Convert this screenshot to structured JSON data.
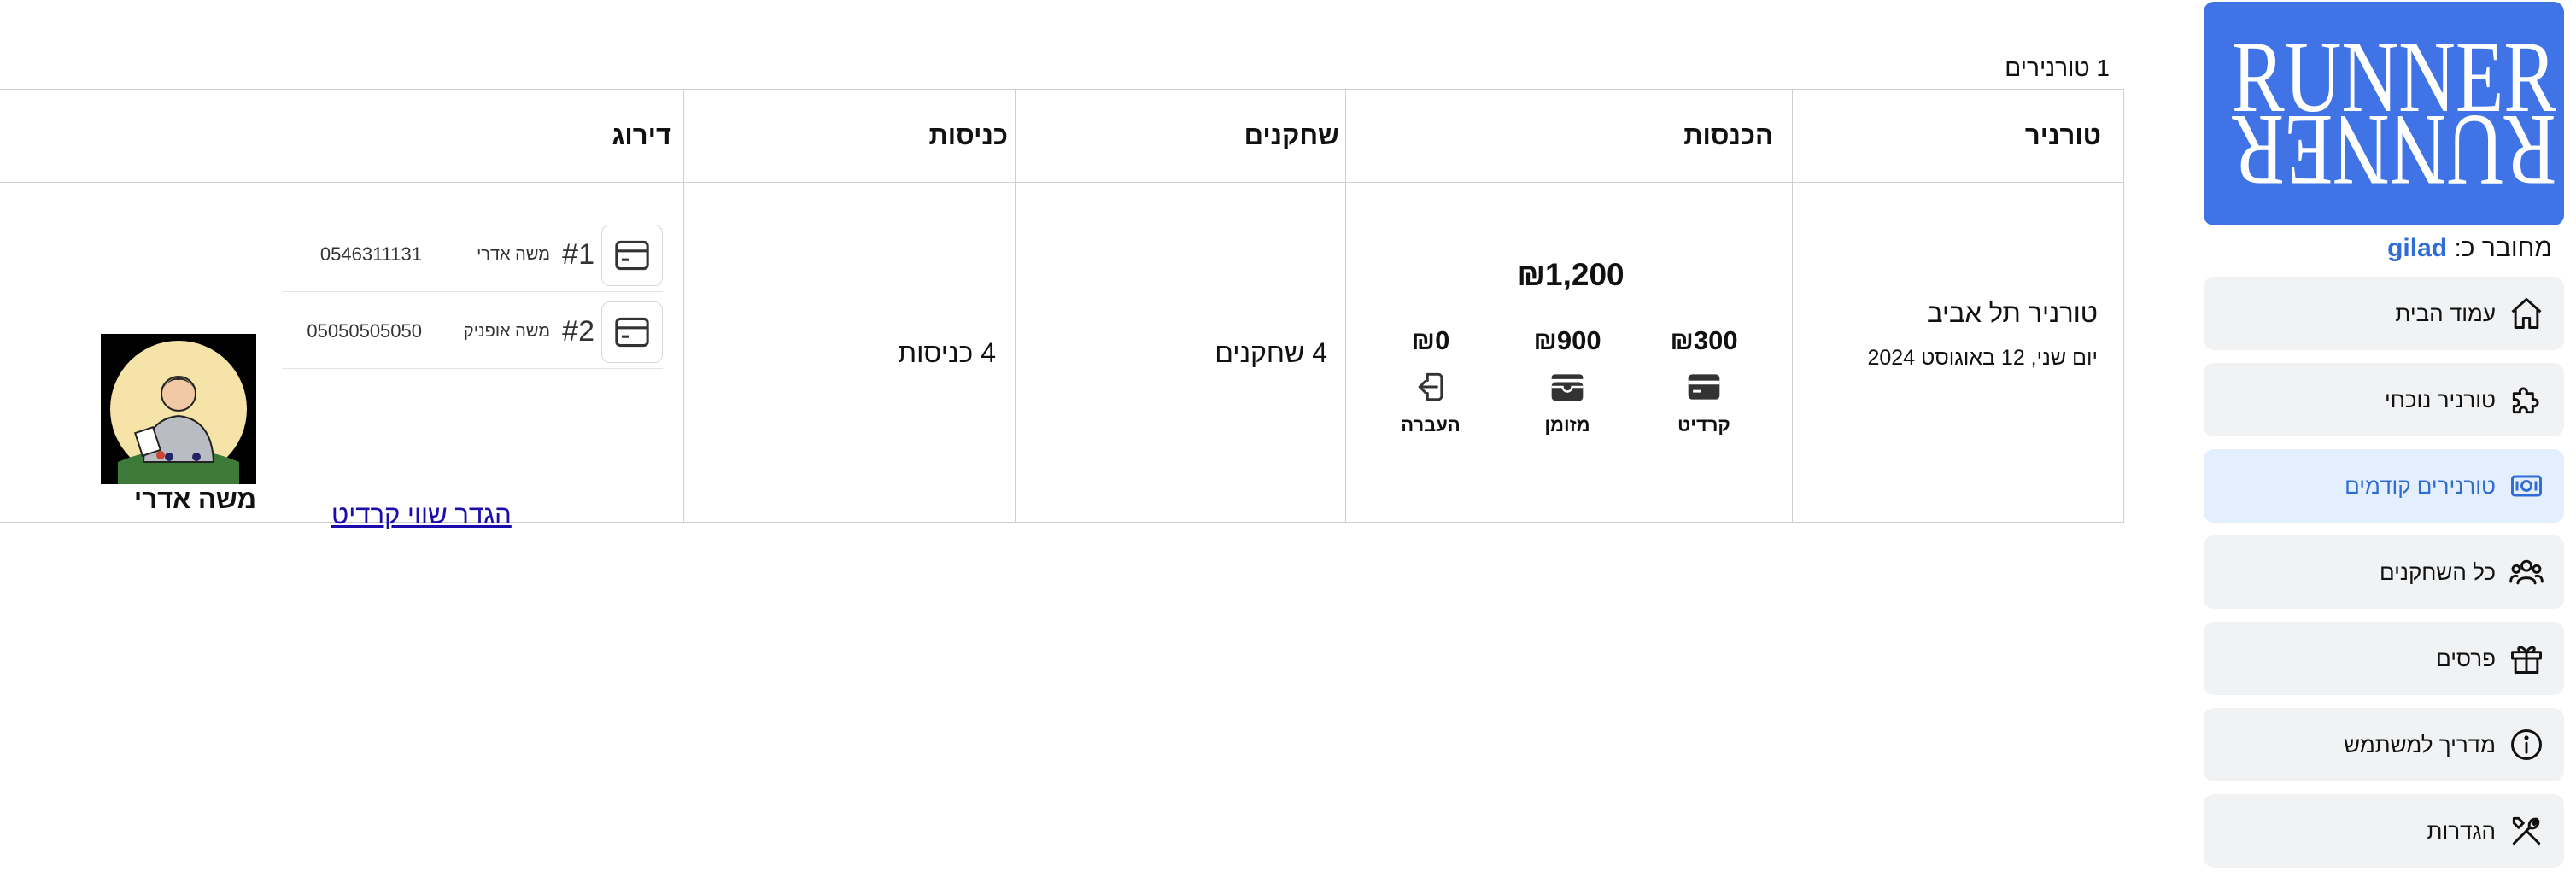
{
  "sidebar": {
    "logo_top": "RUNNER",
    "logo_bottom": "RUNNER",
    "connected_prefix": "מחובר כ:",
    "connected_user": "gilad",
    "items": [
      {
        "label": "עמוד הבית",
        "icon": "home-icon"
      },
      {
        "label": "טורניר נוכחי",
        "icon": "puzzle-icon"
      },
      {
        "label": "טורנירים קודמים",
        "icon": "cash-icon"
      },
      {
        "label": "כל השחקנים",
        "icon": "users-icon"
      },
      {
        "label": "פרסים",
        "icon": "gift-icon"
      },
      {
        "label": "מדריך למשתמש",
        "icon": "info-icon"
      },
      {
        "label": "הגדרות",
        "icon": "tools-icon"
      }
    ],
    "active_index": 2
  },
  "main": {
    "tournament_count": "1 טורנירים",
    "headers": {
      "tournament": "טורניר",
      "income": "הכנסות",
      "players": "שחקנים",
      "entries": "כניסות",
      "ranking": "דירוג"
    },
    "row": {
      "tournament_name": "טורניר תל אביב",
      "tournament_date": "יום שני, 12 באוגוסט 2024",
      "income_total": "₪1,200",
      "income_items": [
        {
          "amount": "₪300",
          "label": "קרדיט",
          "icon": "credit-card-icon"
        },
        {
          "amount": "₪900",
          "label": "מזומן",
          "icon": "wallet-icon"
        },
        {
          "amount": "₪0",
          "label": "העברה",
          "icon": "transfer-icon"
        }
      ],
      "players": "4 שחקנים",
      "entries": "4 כניסות",
      "ranking": [
        {
          "rank": "#1",
          "name": "משה אדרי",
          "phone": "0546311131"
        },
        {
          "rank": "#2",
          "name": "משה אופניק",
          "phone": "05050505050"
        }
      ],
      "set_credit_link": "הגדר שווי קרדיט",
      "winner_name": "משה אדרי"
    }
  },
  "colors": {
    "brand": "#3f73e6",
    "active_nav_bg": "#e3effc",
    "active_nav_text": "#2f6cd6",
    "nav_bg": "#f1f2f4",
    "link": "#1a0dab"
  }
}
